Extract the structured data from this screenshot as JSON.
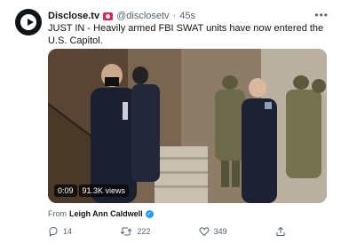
{
  "tweet": {
    "display_name": "Disclose.tv",
    "handle": "@disclosetv",
    "separator": "·",
    "time": "45s",
    "text": "JUST IN - Heavily armed FBI SWAT units have now entered the U.S. Capitol.",
    "video": {
      "timestamp": "0:09",
      "views": "91.3K views"
    },
    "from_prefix": "From",
    "from_name": "Leigh Ann Caldwell",
    "counts": {
      "replies": "14",
      "retweets": "222",
      "likes": "349"
    }
  },
  "icons": {
    "more": "more-icon",
    "reply": "reply-icon",
    "retweet": "retweet-icon",
    "like": "heart-icon",
    "share": "share-icon",
    "verified": "verified-badge-icon",
    "badge": "red-label-icon"
  },
  "colors": {
    "text_primary": "#0f1419",
    "text_secondary": "#536471",
    "verified": "#1d9bf0",
    "badge": "#e0245e"
  }
}
